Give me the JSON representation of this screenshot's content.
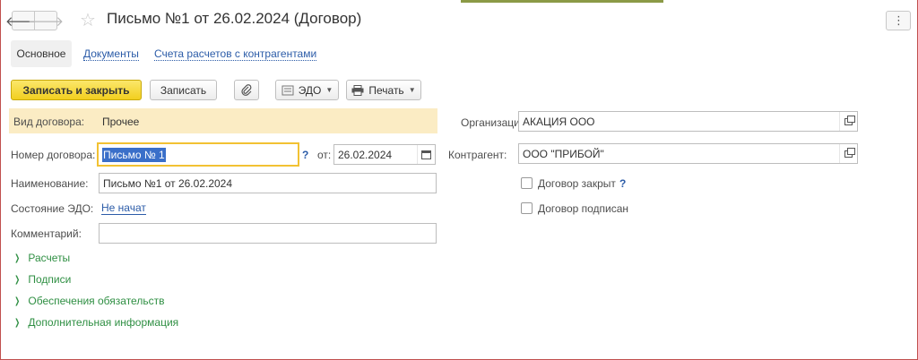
{
  "header": {
    "title": "Письмо №1 от 26.02.2024 (Договор)",
    "back_glyph": "🡐",
    "forward_glyph": "🡒",
    "more_glyph": "⋮"
  },
  "tabs": [
    {
      "label": "Основное",
      "active": true
    },
    {
      "label": "Документы",
      "active": false
    },
    {
      "label": "Счета расчетов с контрагентами",
      "active": false
    }
  ],
  "toolbar": {
    "save_close_label": "Записать и закрыть",
    "save_label": "Записать",
    "edo_label": "ЭДО",
    "print_label": "Печать"
  },
  "form": {
    "contract_type": {
      "label": "Вид договора:",
      "value": "Прочее"
    },
    "contract_number": {
      "label": "Номер договора:",
      "value": "Письмо № 1",
      "date_label": "от:",
      "date_value": "26.02.2024"
    },
    "name": {
      "label": "Наименование:",
      "value": "Письмо №1 от 26.02.2024"
    },
    "edo_state": {
      "label": "Состояние ЭДО:",
      "value": "Не начат"
    },
    "comment": {
      "label": "Комментарий:",
      "value": ""
    },
    "organization": {
      "label": "Организация:",
      "value": "АКАЦИЯ ООО"
    },
    "counterparty": {
      "label": "Контрагент:",
      "value": "ООО \"ПРИБОЙ\""
    },
    "contract_closed": {
      "label": "Договор закрыт",
      "checked": false
    },
    "contract_signed": {
      "label": "Договор подписан",
      "checked": false
    },
    "help_mark": "?"
  },
  "groups": [
    {
      "label": "Расчеты"
    },
    {
      "label": "Подписи"
    },
    {
      "label": "Обеспечения обязательств"
    },
    {
      "label": "Дополнительная информация"
    }
  ],
  "colors": {
    "primary_button": "#f2cf1f",
    "link": "#2c5ca8",
    "group_link": "#2f8f43",
    "highlight_band": "#fbecc4",
    "focus_border": "#f2c233"
  }
}
